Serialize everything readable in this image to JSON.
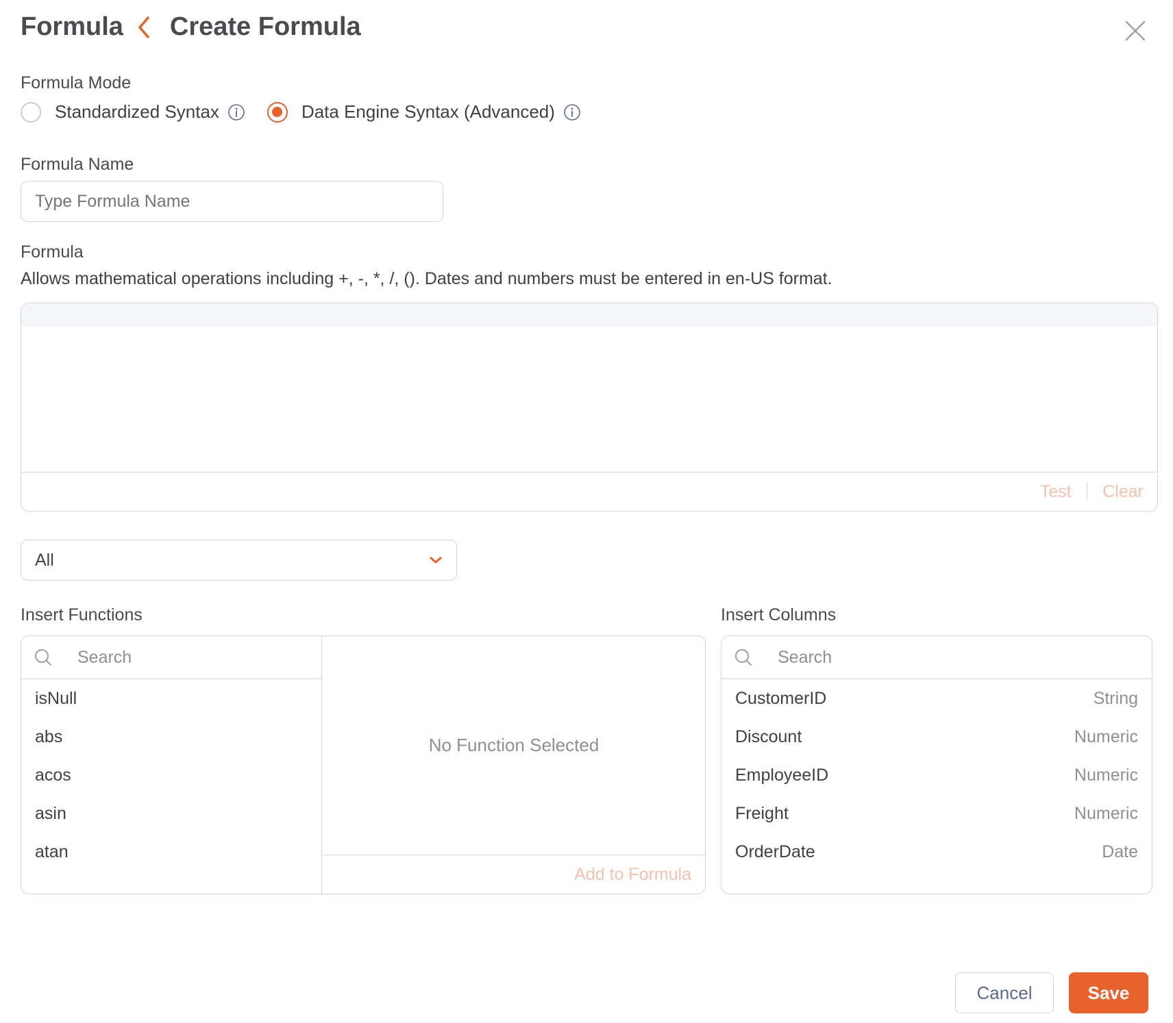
{
  "header": {
    "breadcrumb_root": "Formula",
    "title": "Create Formula"
  },
  "formula_mode": {
    "label": "Formula Mode",
    "options": [
      {
        "label": "Standardized Syntax",
        "selected": false
      },
      {
        "label": "Data Engine Syntax (Advanced)",
        "selected": true
      }
    ]
  },
  "formula_name": {
    "label": "Formula Name",
    "placeholder": "Type Formula Name",
    "value": ""
  },
  "formula": {
    "label": "Formula",
    "description": "Allows mathematical operations including +, -, *, /, (). Dates and numbers must be entered in en-US format.",
    "value": "",
    "test_label": "Test",
    "clear_label": "Clear"
  },
  "category_select": {
    "value": "All"
  },
  "functions": {
    "label": "Insert Functions",
    "search_placeholder": "Search",
    "items": [
      "isNull",
      "abs",
      "acos",
      "asin",
      "atan"
    ],
    "empty_text": "No Function Selected",
    "add_label": "Add to Formula"
  },
  "columns": {
    "label": "Insert Columns",
    "search_placeholder": "Search",
    "items": [
      {
        "name": "CustomerID",
        "type": "String"
      },
      {
        "name": "Discount",
        "type": "Numeric"
      },
      {
        "name": "EmployeeID",
        "type": "Numeric"
      },
      {
        "name": "Freight",
        "type": "Numeric"
      },
      {
        "name": "OrderDate",
        "type": "Date"
      }
    ]
  },
  "footer": {
    "cancel_label": "Cancel",
    "save_label": "Save"
  },
  "colors": {
    "accent": "#e8602c",
    "accent_disabled": "#f4c2ab",
    "border": "#d3d5db"
  },
  "icons": [
    "back-chevron-icon",
    "close-icon",
    "info-icon",
    "chevron-down-icon",
    "search-icon"
  ]
}
